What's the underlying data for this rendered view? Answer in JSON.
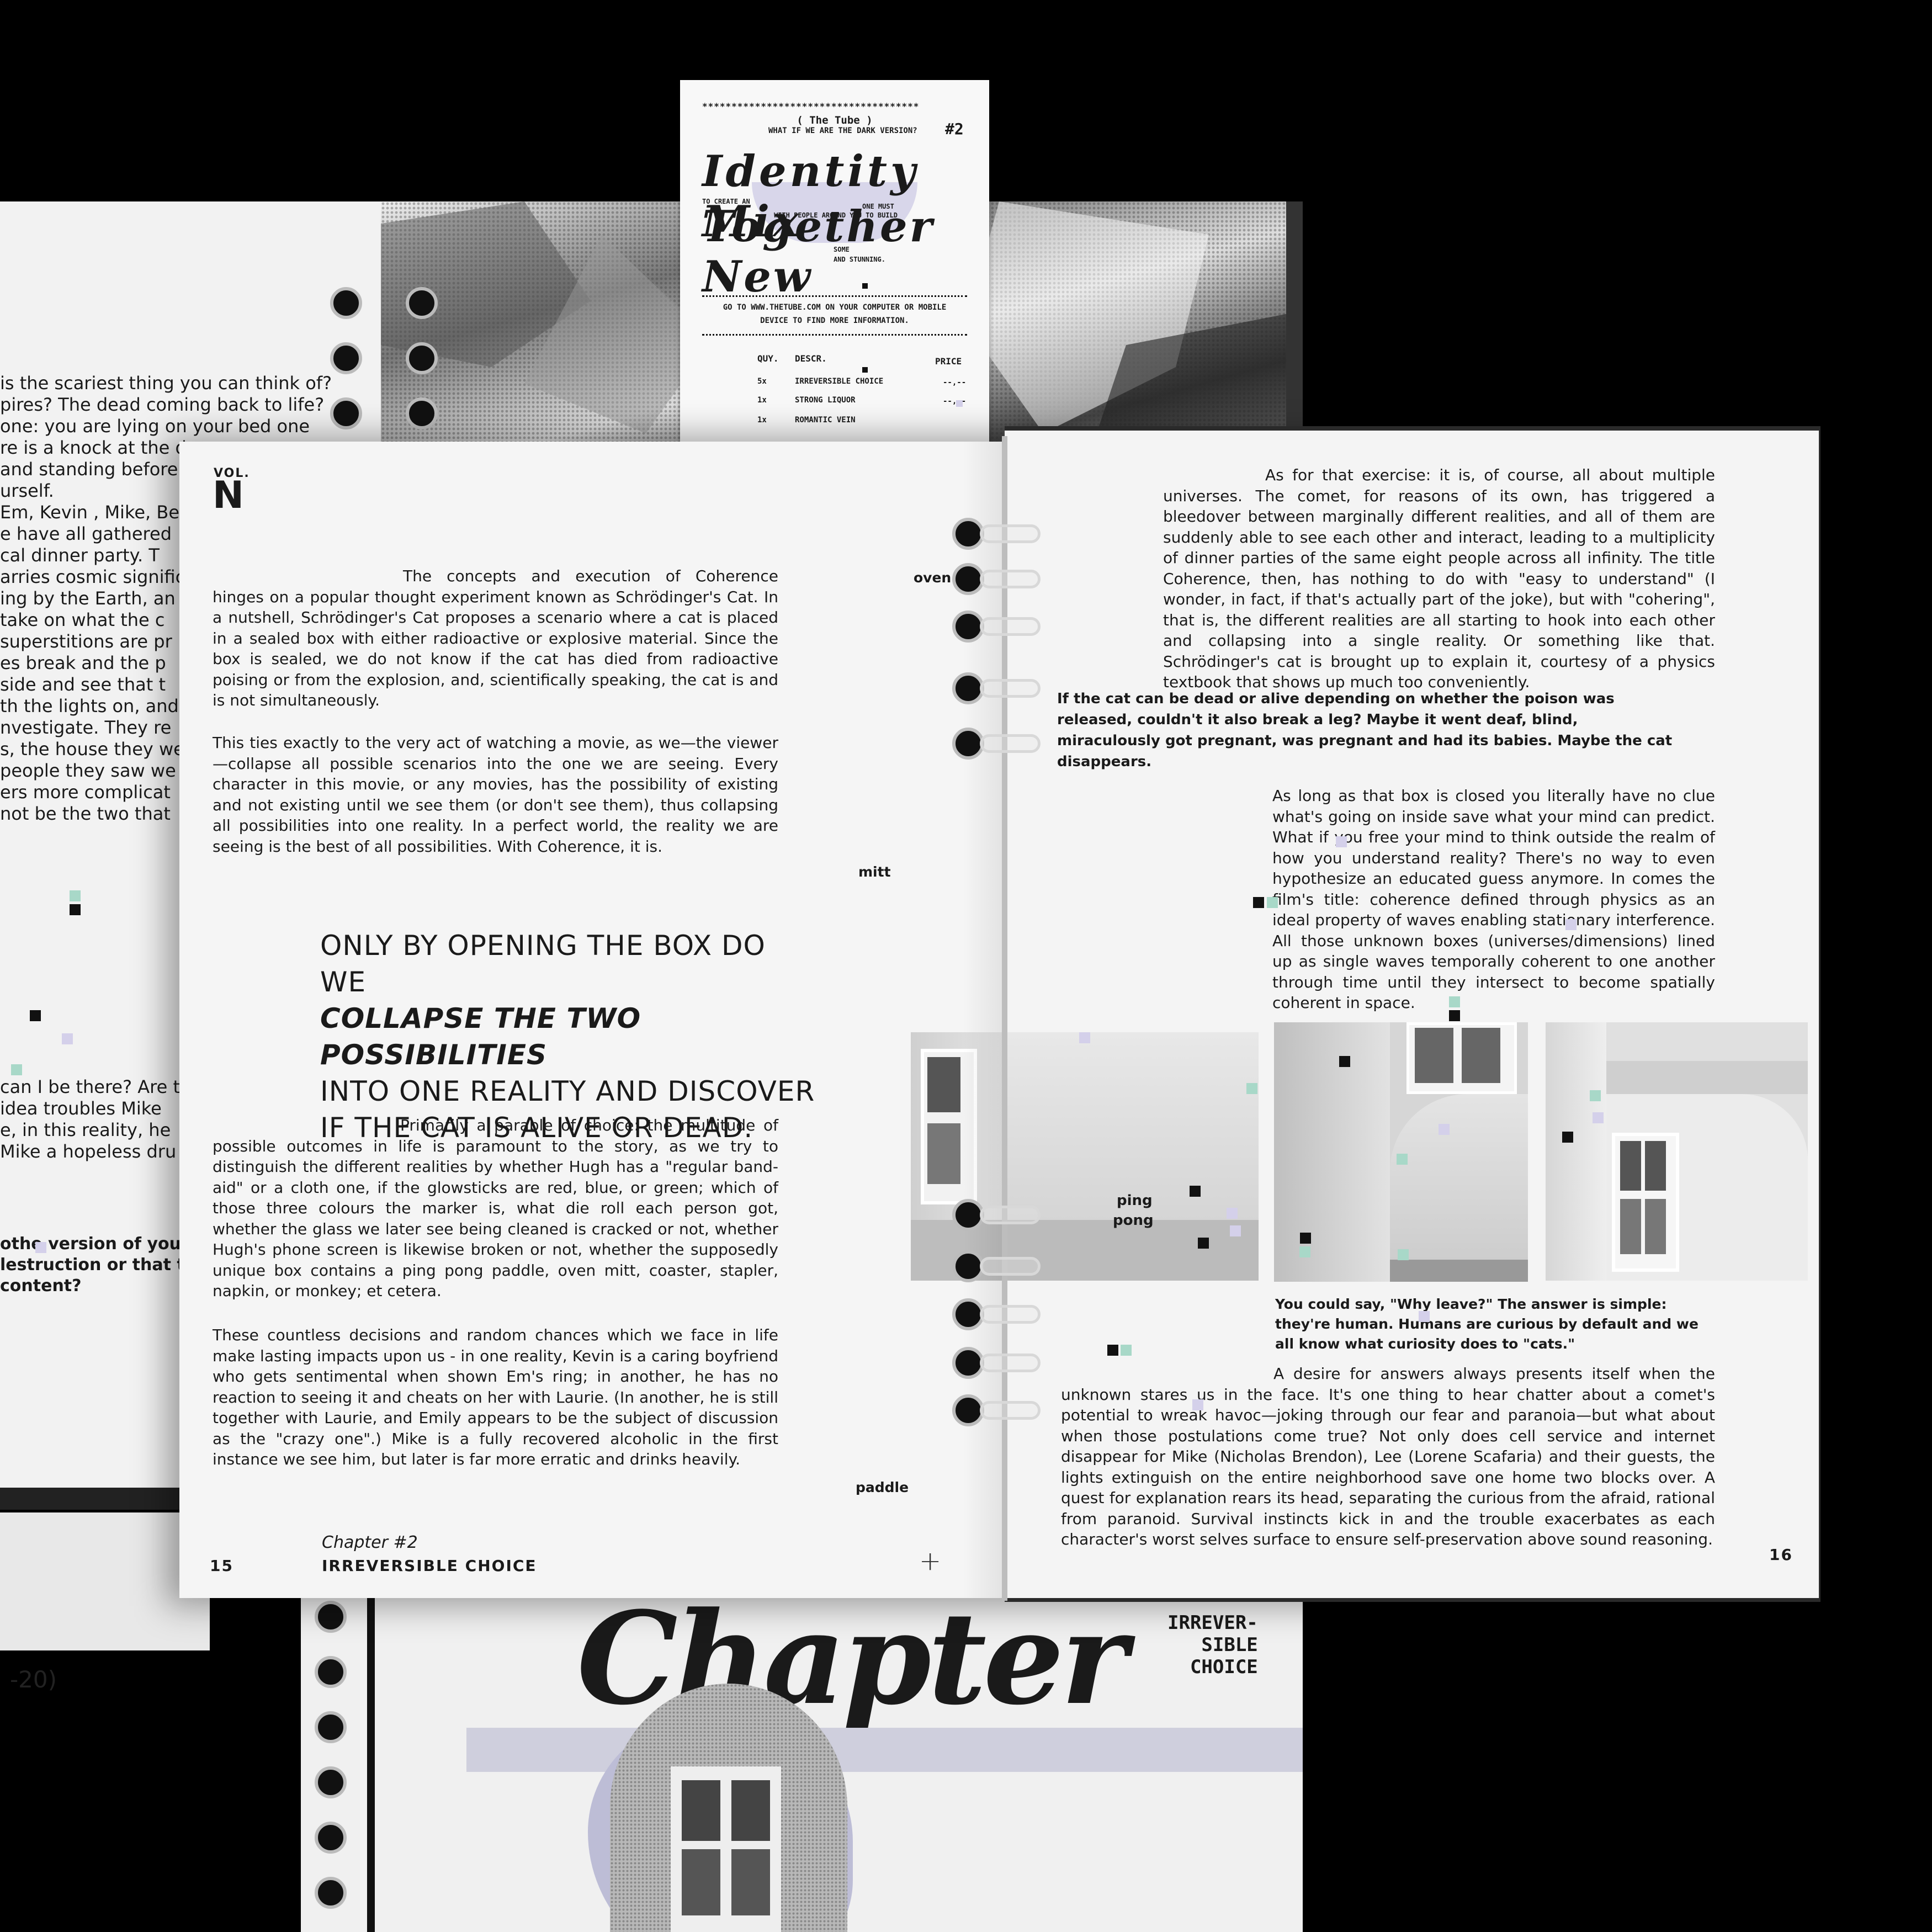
{
  "left_book": {
    "lines": [
      "is the scariest thing you can think of?",
      "pires? The dead coming back to life?",
      "one: you are lying on your bed one",
      "re is a knock at the d",
      "and standing before",
      "urself.",
      "Em, Kevin , Mike, Be",
      "e have all gathered",
      "cal dinner party. T",
      "arries cosmic signific",
      "ing by the Earth, an",
      "take on what the c",
      "superstitions are pr",
      "es break and the p",
      "side and see that t",
      "th the lights on, and",
      "nvestigate. They re",
      "s, the house they we",
      "people they saw we",
      "ers more complicat",
      "not be the two that"
    ],
    "lines_lower": [
      "can I be there? Are t",
      "idea troubles Mike",
      "e, in this reality, he",
      "Mike a hopeless dru"
    ],
    "bold_lines": [
      "othe version of you",
      "lestruction or that the",
      "content?"
    ],
    "page_ref": "-20)"
  },
  "receipt": {
    "stars": "*************************************",
    "title": "( The Tube )",
    "question": "WHAT IF WE ARE THE DARK VERSION?",
    "number": "#2",
    "art_line1": "Identity Mix",
    "art_line2": "Together New",
    "small1": "TO CREATE AN",
    "small2": "ONE MUST",
    "small3": "WITH PEOPLE AROUND YOU TO BUILD",
    "small4": "SOME",
    "small5": "AND STUNNING.",
    "info": "GO TO WWW.THETUBE.COM ON YOUR COMPUTER OR MOBILE DEVICE TO FIND MORE INFORMATION.",
    "headers": [
      "QUY.",
      "DESCR.",
      "PRICE"
    ],
    "rows": [
      {
        "qty": "5x",
        "desc": "IRREVERSIBLE CHOICE",
        "price": "--,--"
      },
      {
        "qty": "1x",
        "desc": "STRONG LIQUOR",
        "price": "--,--"
      },
      {
        "qty": "1x",
        "desc": "ROMANTIC VEIN",
        "price": ""
      }
    ]
  },
  "page15": {
    "vol_label": "VOL.",
    "vol_letter": "N",
    "para1": "The concepts and execution of Coherence hinges on a popular thought experiment known as Schrödinger's Cat. In a nutshell, Schrödinger's Cat proposes a scenario where a cat is placed in a sealed box with either radioactive or explosive material. Since the box is sealed, we do not know if the cat has died from radioactive poising or from the explosion, and, scientifically speaking, the cat is and is not simultaneously.",
    "para2": "This ties exactly to the very act of watching a movie, as we—the viewer—collapse all possible scenarios into the one we are seeing. Every character in this movie, or any movies, has the possibility of existing and not existing until we see them (or don't see them), thus collapsing all possibilities into one reality. In a perfect world, the reality we are seeing is the best of all possibilities. With Coherence, it is.",
    "quote_lines": [
      "ONLY BY OPENING THE BOX DO WE",
      "COLLAPSE THE TWO POSSIBILITIES",
      "INTO ONE REALITY AND DISCOVER",
      "IF THE CAT IS ALIVE OR DEAD."
    ],
    "para3": "Primarily a parable of choice: the multitude of possible outcomes in life is paramount to the story, as we try to distinguish the different realities by whether Hugh has a \"regular band-aid\" or a cloth one, if the glowsticks are red, blue, or green; which of those three colours the marker is, what die roll each person got, whether the glass we later see being cleaned is cracked or not, whether Hugh's phone screen is likewise broken or not, whether the supposedly unique box contains a ping pong paddle, oven mitt, coaster, stapler, napkin, or monkey; et cetera.",
    "para4": "These countless decisions and random chances which we face in life make lasting impacts upon us - in one reality, Kevin is a caring boyfriend who gets sentimental when shown Em's ring; in another, he has no reaction to seeing it and cheats on her with Laurie. (In another, he is still together with Laurie, and Emily appears to be the subject of discussion as the \"crazy one\".) Mike is a fully recovered alcoholic in the first instance we see him, but later is far more erratic and drinks heavily.",
    "margin_oven": "oven",
    "margin_mitt": "mitt",
    "margin_paddle": "paddle",
    "page_number": "15",
    "chapter": "Chapter #2",
    "chapter_title": "IRREVERSIBLE CHOICE",
    "plus": "+"
  },
  "page16": {
    "para1": "As for that exercise: it is, of course, all about multiple universes. The comet, for reasons of its own, has triggered a bleedover between marginally different realities, and all of them are suddenly able to see each other and interact, leading to a multiplicity of dinner parties of the same eight people across all infinity. The title Coherence, then, has nothing to do with \"easy to understand\" (I wonder, in fact, if that's actually part of the joke), but with \"cohering\", that is, the different realities are all starting to hook into each other and collapsing into a single reality. Or something like that. Schrödinger's cat is brought up to explain it, courtesy of a physics textbook that shows up much too conveniently.",
    "bold1": "If the cat can be dead or alive depending on whether the poison was released, couldn't it also break a leg? Maybe it went deaf, blind, miraculously got pregnant, was pregnant and had its babies. Maybe the cat disappears.",
    "para2": "As long as that box is closed you literally have no clue what's going on inside save what your mind can predict. What if you free your mind to think outside the realm of how you understand reality? There's no way to even hypothesize an educated guess anymore. In comes the film's title: coherence defined through physics as an ideal property of waves enabling stationary interference. All those unknown boxes (universes/dimensions) lined up as single waves temporally coherent to one another through time until they intersect to become spatially coherent in space.",
    "margin_ping": "ping",
    "margin_pong": "pong",
    "bold2": "You could say, \"Why leave?\" The answer is simple: they're human. Humans are curious by default and we all know what curiosity does to \"cats.\"",
    "para3": "A desire for answers always presents itself when the unknown stares us in the face. It's one thing to hear chatter about a comet's potential to wreak havoc—joking through our fear and paranoia—but what about when those postulations come true? Not only does cell service and internet disappear for Mike (Nicholas Brendon), Lee (Lorene Scafaria) and their guests, the lights extinguish on the entire neighborhood save one home two blocks over. A quest for explanation rears its head, separating the curious from the afraid, rational from paranoid. Survival instincts kick in and the trouble exacerbates as each character's worst selves surface to ensure self-preservation above sound reasoning.",
    "page_number": "16"
  },
  "lower_book": {
    "title_art": "Chapter",
    "side_label": "IRREVER-\nSIBLE\nCHOICE"
  }
}
